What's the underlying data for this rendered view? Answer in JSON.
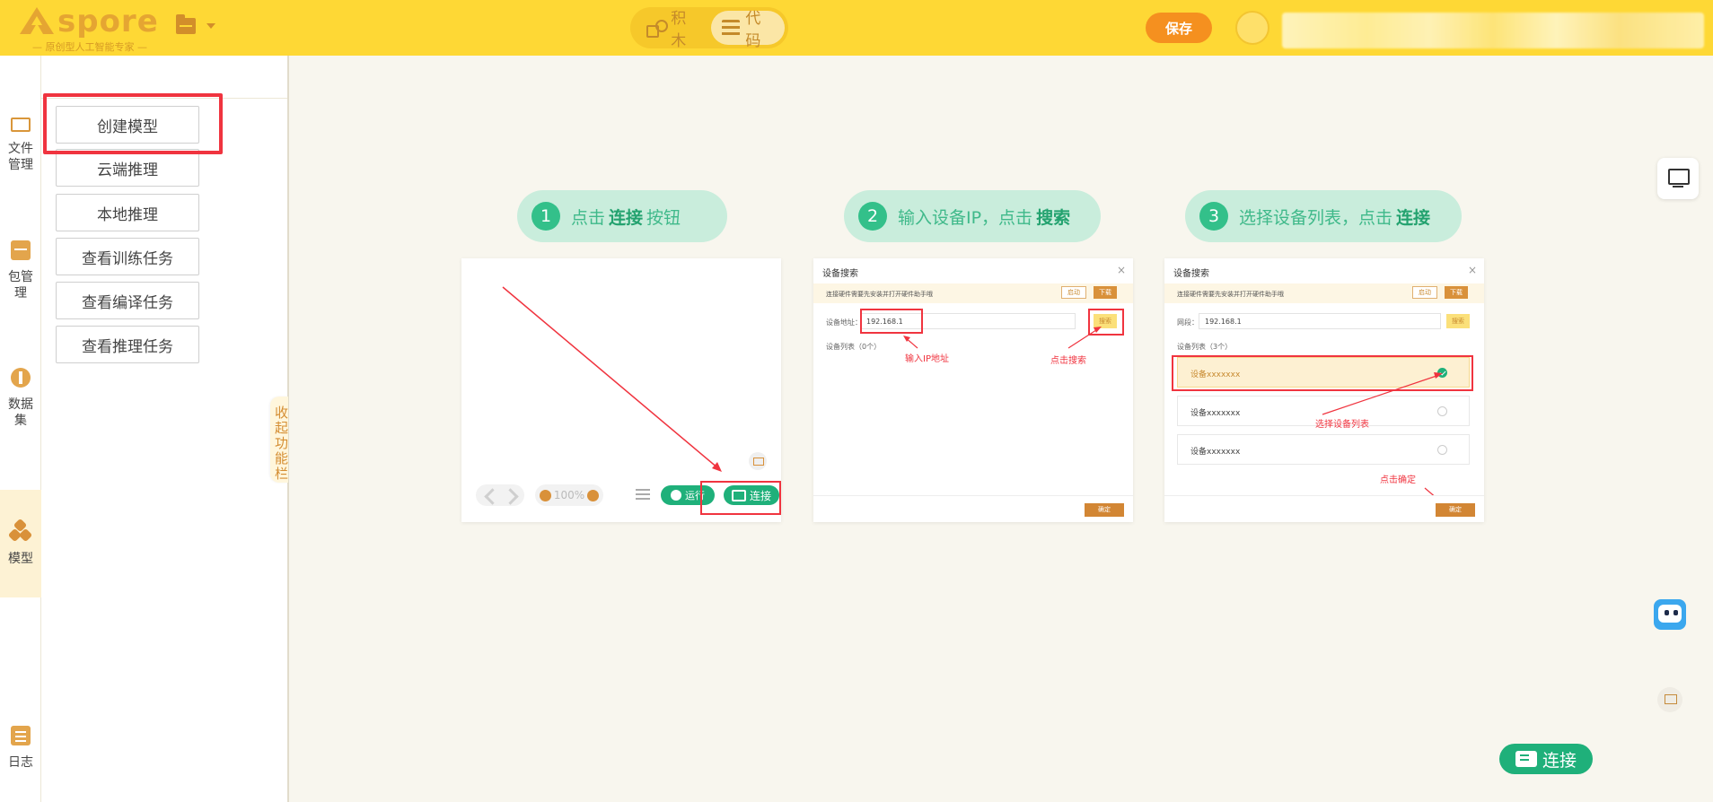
{
  "header": {
    "logo_name": "spore",
    "logo_tagline": "— 原创型人工智能专家 —",
    "modes": [
      {
        "label": "积木",
        "icon": "blocks-icon",
        "active": false
      },
      {
        "label": "代码",
        "icon": "code-icon",
        "active": true
      }
    ],
    "save_label": "保存",
    "accent": "#fed835",
    "save_color": "#f5901f"
  },
  "rail": {
    "items": [
      {
        "label": "文件管理",
        "icon": "folder-icon"
      },
      {
        "label": "包管理",
        "icon": "package-icon"
      },
      {
        "label": "数据集",
        "icon": "dataset-icon"
      },
      {
        "label": "模型",
        "icon": "model-icon",
        "active": true
      },
      {
        "label": "日志",
        "icon": "log-icon"
      }
    ]
  },
  "panel": {
    "buttons": [
      "创建模型",
      "云端推理",
      "本地推理",
      "查看训练任务",
      "查看编译任务",
      "查看推理任务"
    ],
    "collapse_label": "收起功能栏"
  },
  "steps": [
    {
      "num": "1",
      "pre": "点击",
      "bold": "连接",
      "post": "按钮"
    },
    {
      "num": "2",
      "pre": "输入设备IP，点击",
      "bold": "搜索",
      "post": ""
    },
    {
      "num": "3",
      "pre": "选择设备列表，点击",
      "bold": "连接",
      "post": ""
    }
  ],
  "card1": {
    "zoom": "100%",
    "run_label": "运行",
    "connect_label": "连接"
  },
  "card2": {
    "title": "设备搜索",
    "tip": "连接硬件需要先安装并打开硬件助手哦",
    "btn_start": "启动",
    "btn_download": "下载",
    "addr_label": "设备地址：",
    "addr_value": "192.168.1",
    "search_label": "搜索",
    "list_label": "设备列表（0个）",
    "note_ip": "输入IP地址",
    "note_search": "点击搜索",
    "ok_label": "确定"
  },
  "card3": {
    "title": "设备搜索",
    "tip": "连接硬件需要先安装并打开硬件助手哦",
    "btn_start": "启动",
    "btn_download": "下载",
    "addr_label": "网段：",
    "addr_value": "192.168.1",
    "search_label": "搜索",
    "list_label": "设备列表（3个）",
    "devices": [
      "设备xxxxxxx",
      "设备xxxxxxx",
      "设备xxxxxxx"
    ],
    "note_select": "选择设备列表",
    "note_confirm": "点击确定",
    "ok_label": "确定"
  },
  "floating": {
    "connect_label": "连接"
  }
}
